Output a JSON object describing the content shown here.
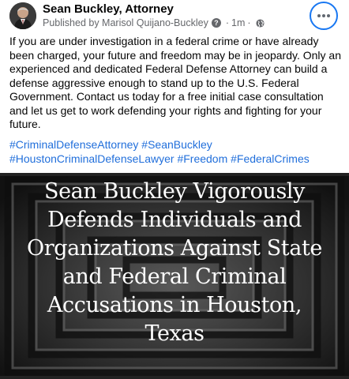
{
  "post": {
    "author": "Sean Buckley, Attorney",
    "published_by_label": "Published by Marisol Quijano-Buckley",
    "question_icon_glyph": "?",
    "separator": "·",
    "time": "1m",
    "separator2": "·",
    "privacy_icon": "globe-icon",
    "more_icon": "more-horizontal-icon",
    "body": "If you are under investigation in a federal crime or have already been charged, your future and freedom may be in jeopardy. Only an experienced and dedicated Federal Defense Attorney can build a defense aggressive enough to stand up to the U.S. Federal Government. Contact us today for a free initial case consultation and let us get to work defending your rights and fighting for your future.",
    "hashtags": [
      "#CriminalDefenseAttorney",
      "#SeanBuckley",
      "#HoustonCriminalDefenseLawyer",
      "#Freedom",
      "#FederalCrimes"
    ]
  },
  "image": {
    "caption_lines": [
      "Sean Buckley Vigorously",
      "Defends Individuals and",
      "Organizations Against State",
      "and Federal Criminal",
      "Accusations in Houston,",
      "Texas"
    ]
  },
  "colors": {
    "hashtag": "#216fdb",
    "more_button_ring": "#1877f2",
    "meta_text": "#65676b"
  }
}
